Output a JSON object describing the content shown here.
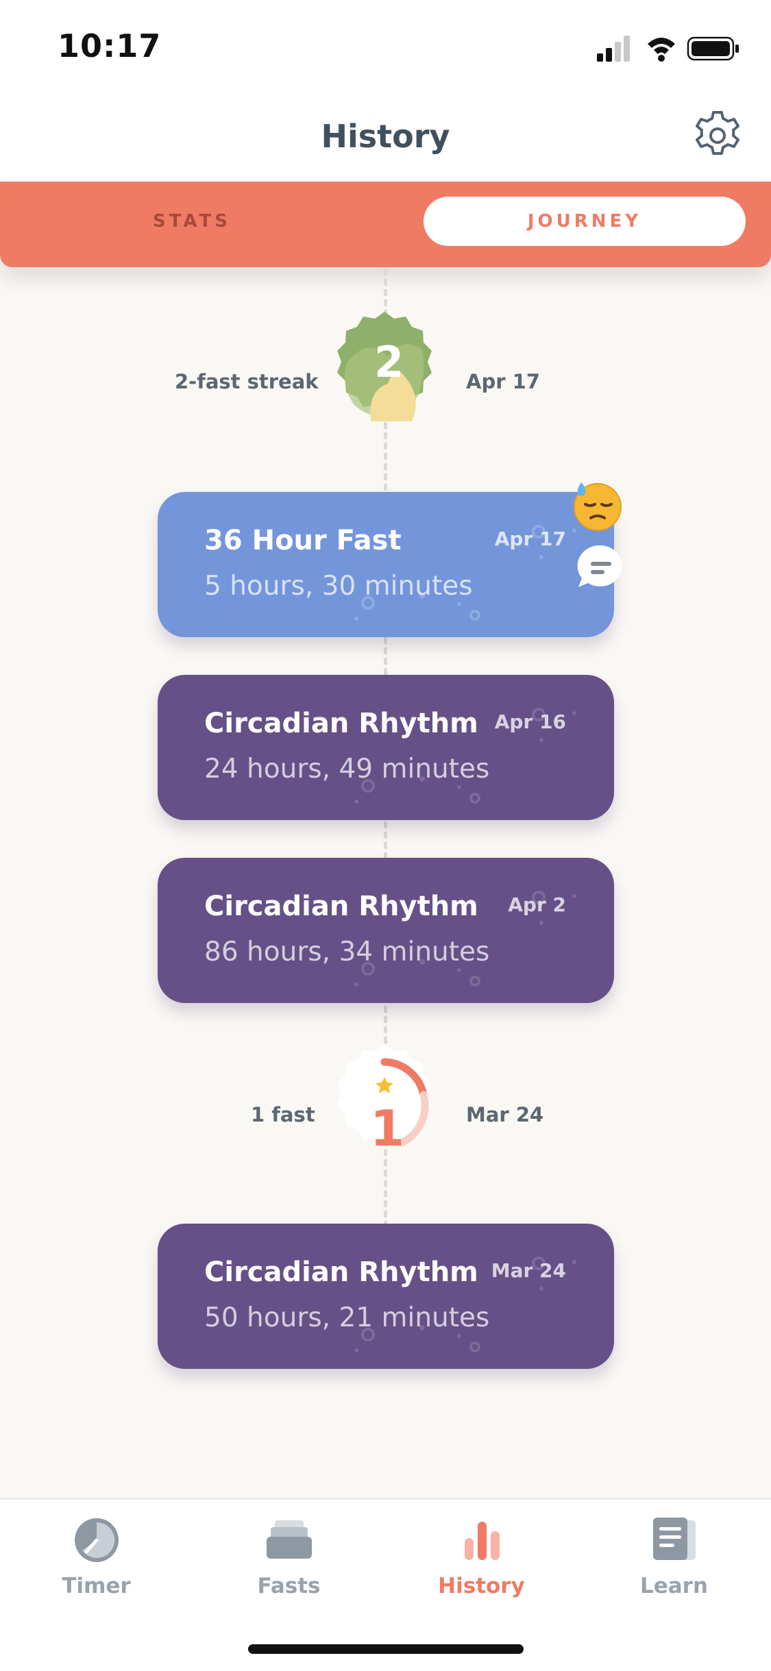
{
  "status_bar": {
    "time": "10:17"
  },
  "header": {
    "title": "History"
  },
  "segments": {
    "stats_label": "STATS",
    "journey_label": "JOURNEY",
    "selected": "JOURNEY"
  },
  "milestones": [
    {
      "badge_number": "2",
      "label": "2-fast streak",
      "date": "Apr 17"
    },
    {
      "badge_number": "1",
      "label": "1 fast",
      "date": "Mar 24"
    }
  ],
  "fasts": [
    {
      "title": "36 Hour Fast",
      "duration": "5 hours, 30 minutes",
      "date": "Apr 17",
      "color": "#7395da"
    },
    {
      "title": "Circadian Rhythm",
      "duration": "24 hours, 49 minutes",
      "date": "Apr 16",
      "color": "#655087"
    },
    {
      "title": "Circadian Rhythm",
      "duration": "86 hours, 34 minutes",
      "date": "Apr 2",
      "color": "#655087"
    },
    {
      "title": "Circadian Rhythm",
      "duration": "50 hours, 21 minutes",
      "date": "Mar 24",
      "color": "#655087"
    }
  ],
  "mood": {
    "icon": "downcast-sweat-emoji-icon",
    "note_icon": "speech-bubble-icon"
  },
  "tab_bar": {
    "items": [
      {
        "label": "Timer",
        "icon": "timer-icon"
      },
      {
        "label": "Fasts",
        "icon": "stack-icon"
      },
      {
        "label": "History",
        "icon": "bar-chart-icon"
      },
      {
        "label": "Learn",
        "icon": "article-icon"
      }
    ],
    "active": "History"
  },
  "colors": {
    "accent": "#f07b64",
    "purple_card": "#655087",
    "blue_card": "#7395da",
    "streak_badge": "#8fb06a"
  }
}
